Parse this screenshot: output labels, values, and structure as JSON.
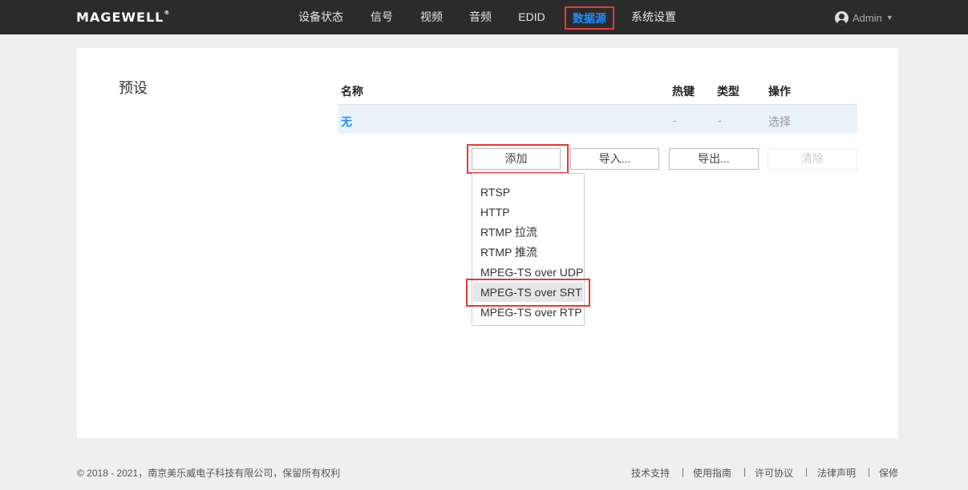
{
  "brand": {
    "logo": "MAGEWELL",
    "reg": "®"
  },
  "nav": {
    "items": [
      "设备状态",
      "信号",
      "视频",
      "音频",
      "EDID",
      "数据源",
      "系统设置"
    ],
    "active": "数据源"
  },
  "user": {
    "name": "Admin"
  },
  "section": {
    "title": "预设"
  },
  "table": {
    "headers": {
      "name": "名称",
      "hotkey": "热键",
      "type": "类型",
      "action": "操作"
    },
    "rows": [
      {
        "name": "无",
        "hotkey": "-",
        "type": "-",
        "action": "选择"
      }
    ]
  },
  "buttons": {
    "add": "添加",
    "import": "导入...",
    "export": "导出...",
    "clear": "清除"
  },
  "add_menu": {
    "items": [
      "RTSP",
      "HTTP",
      "RTMP 拉流",
      "RTMP 推流",
      "MPEG-TS over UDP",
      "MPEG-TS over SRT",
      "MPEG-TS over RTP"
    ],
    "highlighted": "MPEG-TS over SRT"
  },
  "footer": {
    "copyright": "© 2018 - 2021，南京美乐威电子科技有限公司，保留所有权利",
    "links": [
      "技术支持",
      "使用指南",
      "许可协议",
      "法律声明",
      "保修"
    ],
    "separator": "|"
  },
  "colors": {
    "accent": "#1e8fff",
    "highlight": "#e53935",
    "topbar": "#2b2b2b"
  }
}
